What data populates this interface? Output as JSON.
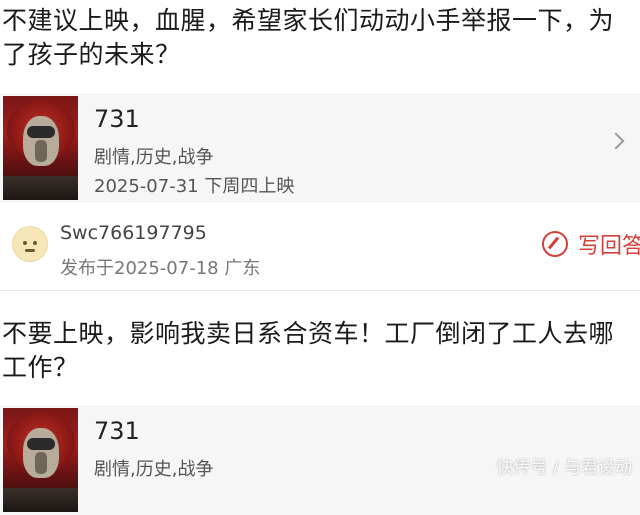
{
  "comments": [
    {
      "text": "不建议上映，血腥，希望家长们动动小手举报一下，为了孩子的未来？",
      "movie": {
        "title": "731",
        "genre": "剧情,历史,战争",
        "release": "2025-07-31 下周四上映"
      }
    },
    {
      "text": "不要上映，影响我卖日系合资车！工厂倒闭了工人去哪工作？",
      "movie": {
        "title": "731",
        "genre": "剧情,历史,战争",
        "release": ""
      }
    }
  ],
  "author": {
    "name": "Swc766197795",
    "meta": "发布于2025-07-18  广东",
    "avatar_icon": "cartoon-face-avatar"
  },
  "actions": {
    "reply_label": "写回答",
    "reply_icon": "edit-icon"
  },
  "watermark": "快传号 / 与君设动",
  "colors": {
    "accent_red": "#d2403a",
    "card_bg": "#f6f6f6",
    "poster_red": "#a01d1d"
  }
}
